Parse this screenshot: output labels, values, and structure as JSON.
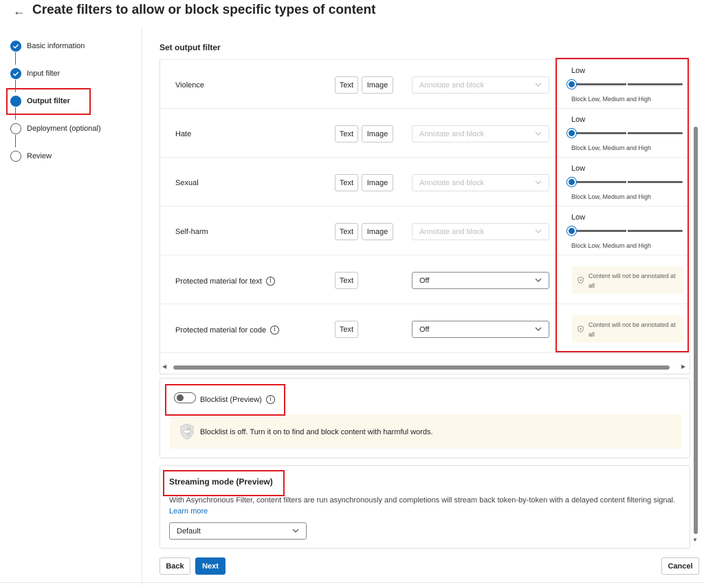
{
  "header": {
    "back_icon": "arrow-left-icon",
    "title": "Create filters to allow or block specific types of content"
  },
  "steps": [
    {
      "label": "Basic information",
      "state": "done"
    },
    {
      "label": "Input filter",
      "state": "done"
    },
    {
      "label": "Output filter",
      "state": "current"
    },
    {
      "label": "Deployment (optional)",
      "state": "todo"
    },
    {
      "label": "Review",
      "state": "todo"
    }
  ],
  "section_title": "Set output filter",
  "filters": [
    {
      "name": "Violence",
      "chips": [
        "Text",
        "Image"
      ],
      "action": "Annotate and block",
      "action_disabled": true,
      "level": "Low",
      "level_value": 0,
      "level_desc": "Block Low, Medium and High"
    },
    {
      "name": "Hate",
      "chips": [
        "Text",
        "Image"
      ],
      "action": "Annotate and block",
      "action_disabled": true,
      "level": "Low",
      "level_value": 0,
      "level_desc": "Block Low, Medium and High"
    },
    {
      "name": "Sexual",
      "chips": [
        "Text",
        "Image"
      ],
      "action": "Annotate and block",
      "action_disabled": true,
      "level": "Low",
      "level_value": 0,
      "level_desc": "Block Low, Medium and High"
    },
    {
      "name": "Self-harm",
      "chips": [
        "Text",
        "Image"
      ],
      "action": "Annotate and block",
      "action_disabled": true,
      "level": "Low",
      "level_value": 0,
      "level_desc": "Block Low, Medium and High"
    },
    {
      "name": "Protected material for text",
      "info": "i",
      "chips": [
        "Text"
      ],
      "action": "Off",
      "action_disabled": false,
      "note": "Content will not be annotated at all"
    },
    {
      "name": "Protected material for code",
      "info": "i",
      "chips": [
        "Text"
      ],
      "action": "Off",
      "action_disabled": false,
      "note": "Content will not be annotated at all"
    }
  ],
  "blocklist": {
    "toggle_on": false,
    "label": "Blocklist (Preview)",
    "info": "i",
    "message": "Blocklist is off. Turn it on to find and block content with harmful words."
  },
  "streaming": {
    "title": "Streaming mode (Preview)",
    "description": "With Asynchronous Filter, content filters are run asynchronously and completions will stream back token-by-token with a delayed content filtering signal.",
    "link": "Learn more",
    "selected": "Default"
  },
  "footer": {
    "back_label": "Back",
    "next_label": "Next",
    "cancel_label": "Cancel"
  },
  "colors": {
    "accent": "#0f6cbd",
    "highlight": "#e0191f",
    "note_bg": "#fdf8ec"
  }
}
